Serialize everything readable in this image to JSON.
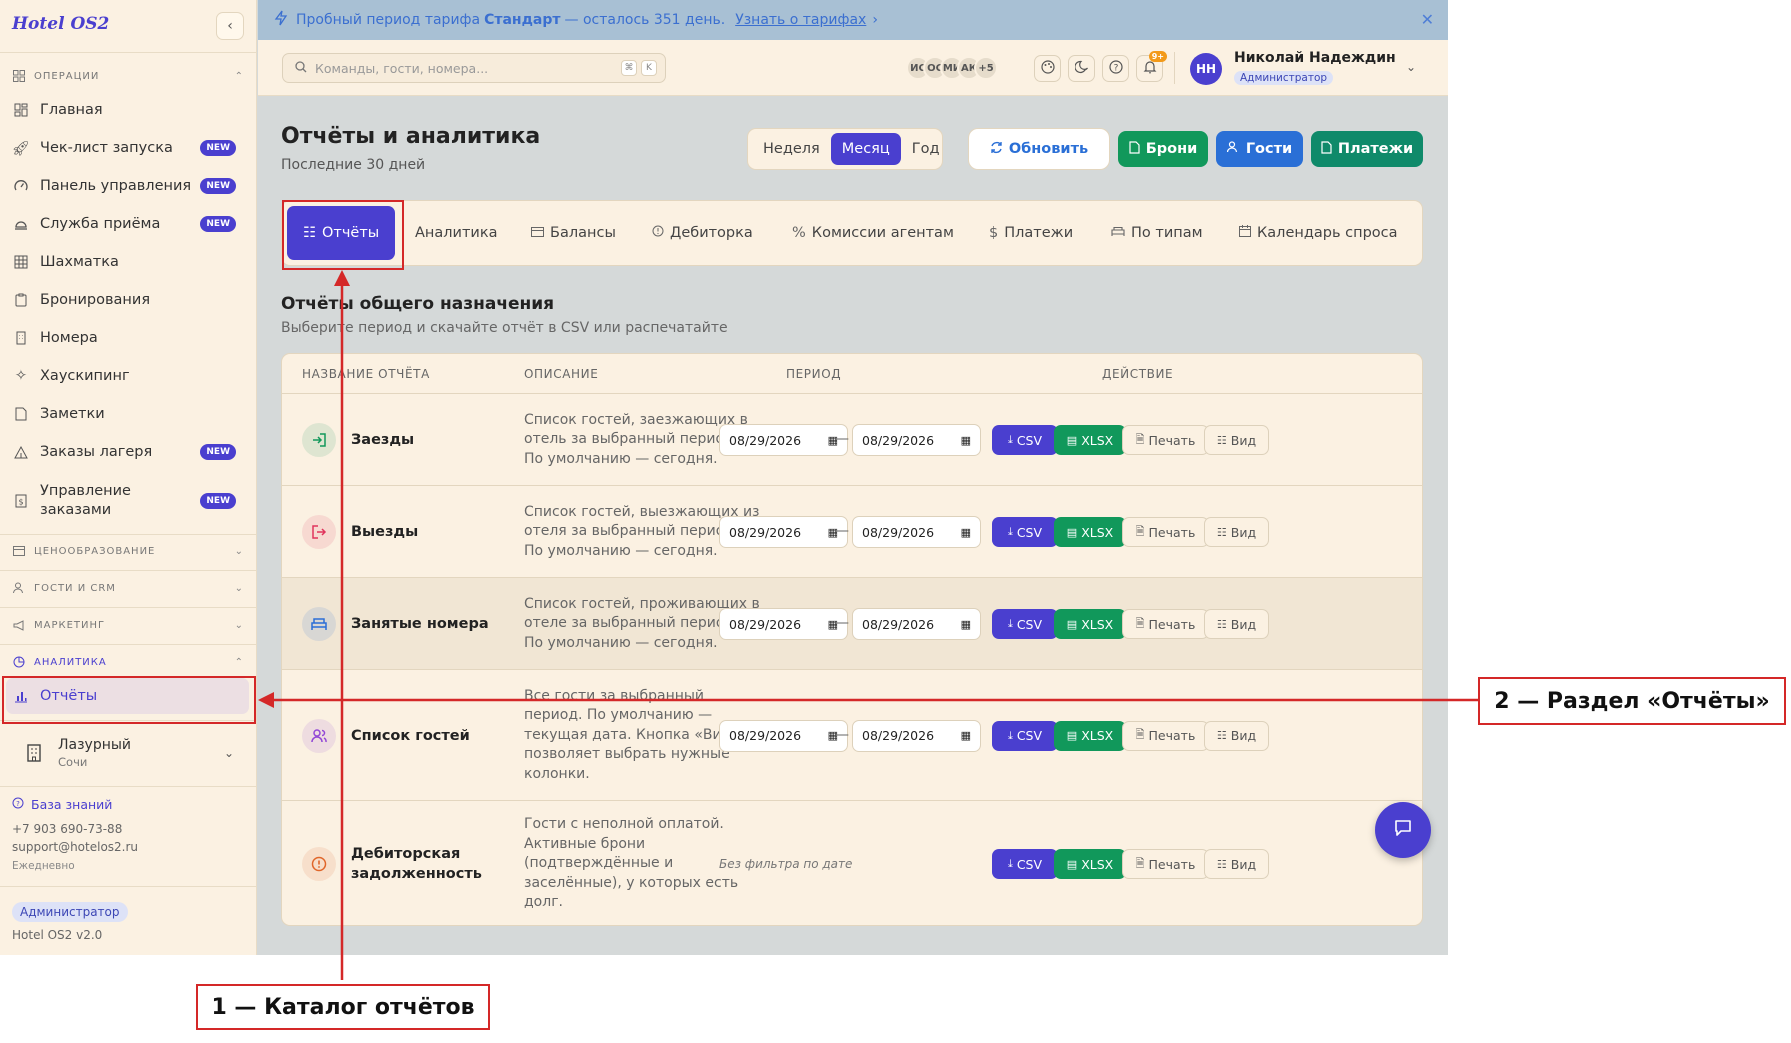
{
  "sidebar": {
    "logo": "Hotel OS2",
    "sections": {
      "operations": "ОПЕРАЦИИ",
      "pricing": "ЦЕНООБРАЗОВАНИЕ",
      "guests_crm": "ГОСТИ И CRM",
      "marketing": "МАРКЕТИНГ",
      "analytics": "АНАЛИТИКА"
    },
    "items": [
      {
        "label": "Главная",
        "badge": ""
      },
      {
        "label": "Чек-лист запуска",
        "badge": "NEW"
      },
      {
        "label": "Панель управления",
        "badge": "NEW"
      },
      {
        "label": "Служба приёма",
        "badge": "NEW"
      },
      {
        "label": "Шахматка",
        "badge": ""
      },
      {
        "label": "Бронирования",
        "badge": ""
      },
      {
        "label": "Номера",
        "badge": ""
      },
      {
        "label": "Хаускипинг",
        "badge": ""
      },
      {
        "label": "Заметки",
        "badge": ""
      },
      {
        "label": "Заказы лагеря",
        "badge": "NEW"
      },
      {
        "label": "Управление заказами",
        "badge": "NEW"
      }
    ],
    "active_item": "Отчёты",
    "hotel": {
      "name": "Лазурный",
      "city": "Сочи"
    },
    "knowledge_base": "База знаний",
    "phone": "+7 903 690-73-88",
    "email": "support@hotelos2.ru",
    "schedule": "Ежедневно",
    "role": "Администратор",
    "version": "Hotel OS2 v2.0"
  },
  "banner": {
    "text_before": "Пробный период тарифа",
    "plan": "Стандарт",
    "text_after": "— осталось 351 день.",
    "link": "Узнать о тарифах",
    "link_chevron": "›",
    "close": "✕"
  },
  "header": {
    "search_placeholder": "Команды, гости, номера...",
    "shortcut": [
      "⌘",
      "K"
    ],
    "avatars": [
      "ИС",
      "ОС",
      "МИ",
      "АК",
      "+5"
    ],
    "notifications": "9+",
    "user_initials": "НН",
    "user_name": "Николай Надеждин",
    "user_role": "Администратор"
  },
  "page": {
    "title": "Отчёты и аналитика",
    "subtitle": "Последние 30 дней",
    "period_options": [
      "Неделя",
      "Месяц",
      "Год"
    ],
    "period_selected": "Месяц",
    "refresh": "Обновить",
    "quick_buttons": [
      "Брони",
      "Гости",
      "Платежи"
    ],
    "quick_colors": [
      "#11985b",
      "#2a6fd6",
      "#0f8a6a"
    ]
  },
  "tabs": [
    "Отчёты",
    "Аналитика",
    "Балансы",
    "Дебиторка",
    "Комиссии агентам",
    "Платежи",
    "По типам",
    "Календарь спроса"
  ],
  "tab_icons": [
    "list-icon",
    "",
    "wallet-icon",
    "alert-circle-icon",
    "percent-icon",
    "dollar-icon",
    "bed-icon",
    "calendar-icon"
  ],
  "reports": {
    "title": "Отчёты общего назначения",
    "subtitle": "Выберите период и скачайте отчёт в CSV или распечатайте",
    "columns": [
      "НАЗВАНИЕ ОТЧЁТА",
      "ОПИСАНИЕ",
      "ПЕРИОД",
      "ДЕЙСТВИЕ"
    ],
    "rows": [
      {
        "name": "Заезды",
        "desc": "Список гостей, заезжающих в отель за выбранный период. По умолчанию — сегодня.",
        "from": "08/29/2026",
        "to": "08/29/2026",
        "icon": "login-icon",
        "color": "#11985b"
      },
      {
        "name": "Выезды",
        "desc": "Список гостей, выезжающих из отеля за выбранный период. По умолчанию — сегодня.",
        "from": "08/29/2026",
        "to": "08/29/2026",
        "icon": "logout-icon",
        "color": "#e0345c"
      },
      {
        "name": "Занятые номера",
        "desc": "Список гостей, проживающих в отеле за выбранный период. По умолчанию — сегодня.",
        "from": "08/29/2026",
        "to": "08/29/2026",
        "icon": "bed-icon",
        "color": "#2a6fd6"
      },
      {
        "name": "Список гостей",
        "desc": "Все гости за выбранный период. По умолчанию — текущая дата. Кнопка «Вид» позволяет выбрать нужные колонки.",
        "from": "08/29/2026",
        "to": "08/29/2026",
        "icon": "users-icon",
        "color": "#9247d6"
      },
      {
        "name": "Дебиторская задолженность",
        "desc": "Гости с неполной оплатой. Активные брони (подтверждённые и заселённые), у которых есть долг.",
        "from": "",
        "to": "",
        "no_filter": "Без фильтра по дате",
        "icon": "alert-circle-icon",
        "color": "#e0662a"
      }
    ],
    "date_sep": "—",
    "actions": {
      "csv": "CSV",
      "xlsx": "XLSX",
      "print": "Печать",
      "view": "Вид"
    }
  },
  "annotations": {
    "callout1": "1 — Каталог отчётов",
    "callout2": "2 — Раздел «Отчёты»",
    "color": "#d42828"
  }
}
